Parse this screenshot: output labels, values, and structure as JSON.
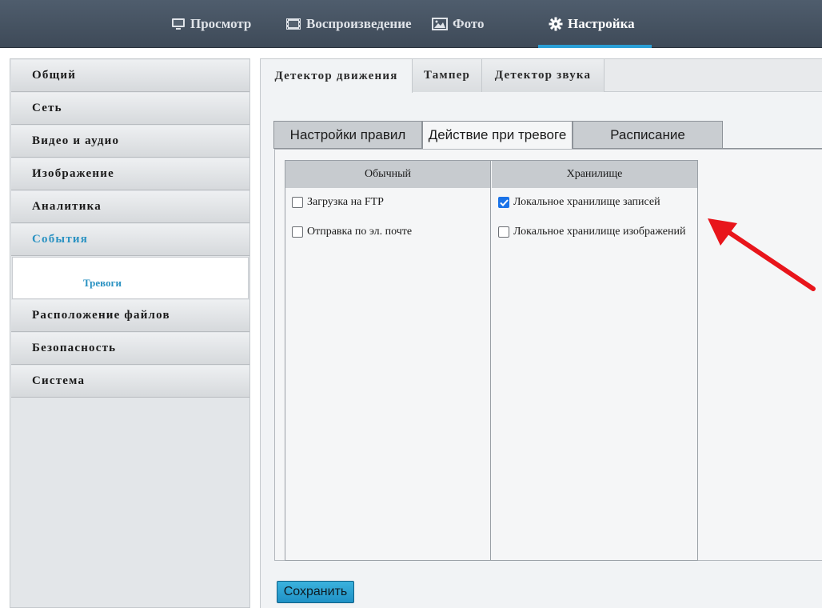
{
  "top_nav": {
    "items": [
      {
        "label": "Просмотр",
        "icon": "monitor-icon"
      },
      {
        "label": "Воспроизведение",
        "icon": "film-icon"
      },
      {
        "label": "Фото",
        "icon": "image-icon"
      },
      {
        "label": "Настройка",
        "icon": "gear-icon",
        "active": true
      }
    ]
  },
  "sidebar": {
    "items": [
      {
        "label": "Общий"
      },
      {
        "label": "Сеть"
      },
      {
        "label": "Видео и аудио"
      },
      {
        "label": "Изображение"
      },
      {
        "label": "Аналитика"
      },
      {
        "label": "События",
        "active": true
      },
      {
        "label": "Расположение файлов"
      },
      {
        "label": "Безопасность"
      },
      {
        "label": "Система"
      }
    ],
    "sub_item": "Тревоги"
  },
  "tabs_top": [
    {
      "label": "Детектор движения",
      "active": true
    },
    {
      "label": "Тампер"
    },
    {
      "label": "Детектор звука"
    }
  ],
  "sub_tabs": [
    {
      "label": "Настройки правил"
    },
    {
      "label": "Действие при тревоге",
      "active": true
    },
    {
      "label": "Расписание"
    }
  ],
  "actions": {
    "normal": {
      "header": "Обычный",
      "options": [
        {
          "label": "Загрузка на FTP",
          "checked": false
        },
        {
          "label": "Отправка по эл. почте",
          "checked": false
        }
      ]
    },
    "storage": {
      "header": "Хранилище",
      "options": [
        {
          "label": "Локальное хранилище записей",
          "checked": true
        },
        {
          "label": "Локальное хранилище изображений",
          "checked": false
        }
      ]
    }
  },
  "save_button": "Сохранить",
  "colors": {
    "accent": "#2a92c2",
    "topbar": "#46535f",
    "annotation_arrow": "#e8151b",
    "button": "#2aa3d4"
  }
}
